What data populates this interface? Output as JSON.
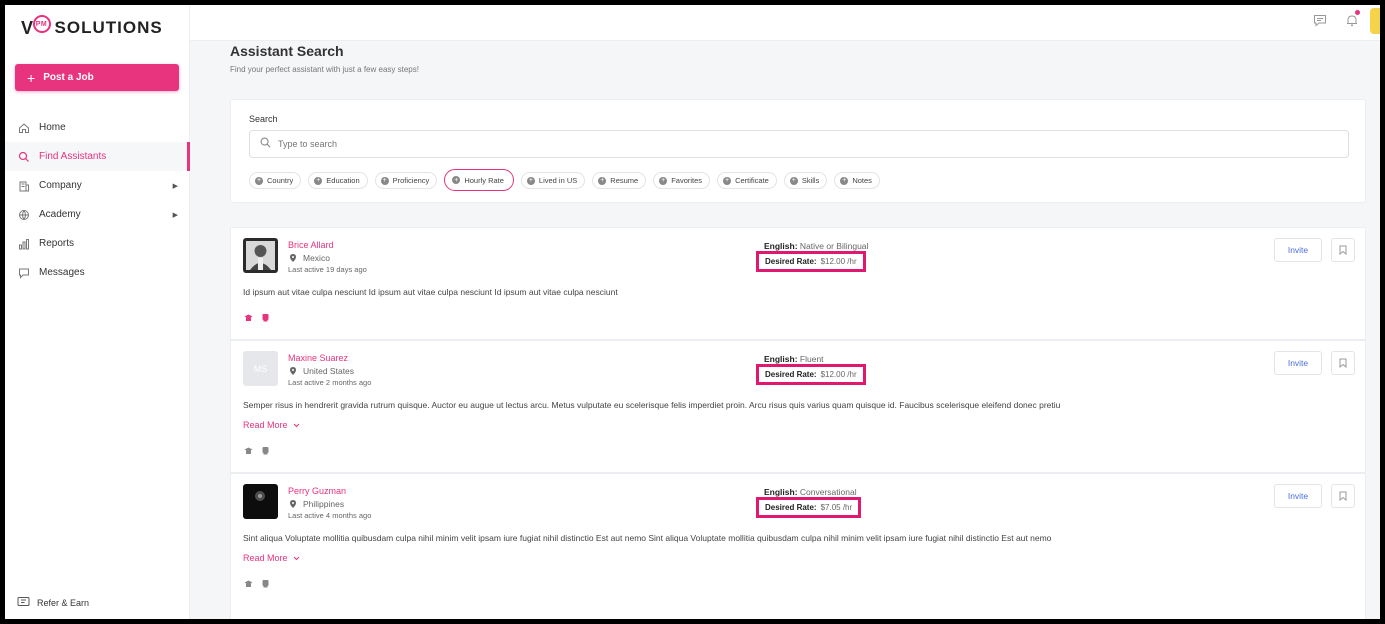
{
  "brand": {
    "logo_v": "V",
    "logo_pm": "PM",
    "logo_word": "SOLUTIONS",
    "accent": "#e8337f"
  },
  "sidebar": {
    "post_job": "Post a Job",
    "items": [
      {
        "label": "Home",
        "icon": "home-icon"
      },
      {
        "label": "Find Assistants",
        "icon": "search-icon",
        "active": true
      },
      {
        "label": "Company",
        "icon": "building-icon",
        "has_submenu": true
      },
      {
        "label": "Academy",
        "icon": "academy-icon",
        "has_submenu": true
      },
      {
        "label": "Reports",
        "icon": "bar-chart-icon"
      },
      {
        "label": "Messages",
        "icon": "chat-icon"
      }
    ],
    "refer": "Refer & Earn"
  },
  "header": {
    "title": "Assistant Search",
    "subtitle": "Find your perfect assistant with just a few easy steps!"
  },
  "search": {
    "label": "Search",
    "placeholder": "Type to search",
    "filters": [
      "Country",
      "Education",
      "Proficiency",
      "Hourly Rate",
      "Lived in US",
      "Resume",
      "Favorites",
      "Certificate",
      "Skills",
      "Notes"
    ],
    "highlighted_filter": "Hourly Rate"
  },
  "results": [
    {
      "name": "Brice Allard",
      "initials": "",
      "location": "Mexico",
      "last_active": "Last active 19 days ago",
      "english_label": "English:",
      "english_level": "Native or Bilingual",
      "rate_label": "Desired Rate:",
      "rate": "$12.00 /hr",
      "description": "Id ipsum aut vitae culpa nesciunt Id ipsum aut vitae culpa nesciunt Id ipsum aut vitae culpa nesciunt",
      "read_more": "",
      "invite": "Invite"
    },
    {
      "name": "Maxine Suarez",
      "initials": "MS",
      "location": "United States",
      "last_active": "Last active 2 months ago",
      "english_label": "English:",
      "english_level": "Fluent",
      "rate_label": "Desired Rate:",
      "rate": "$12.00 /hr",
      "description": "Semper risus in hendrerit gravida rutrum quisque. Auctor eu augue ut lectus arcu. Metus vulputate eu scelerisque felis imperdiet proin. Arcu risus quis varius quam quisque id. Faucibus scelerisque eleifend donec pretiu",
      "read_more": "Read More",
      "invite": "Invite"
    },
    {
      "name": "Perry Guzman",
      "initials": "",
      "location": "Philippines",
      "last_active": "Last active 4 months ago",
      "english_label": "English:",
      "english_level": "Conversational",
      "rate_label": "Desired Rate:",
      "rate": "$7.05 /hr",
      "description": "Sint aliqua Voluptate mollitia quibusdam culpa nihil minim velit ipsam iure fugiat nihil distinctio Est aut nemo Sint aliqua Voluptate mollitia quibusdam culpa nihil minim velit ipsam iure fugiat nihil distinctio Est aut nemo",
      "read_more": "Read More",
      "invite": "Invite"
    }
  ]
}
